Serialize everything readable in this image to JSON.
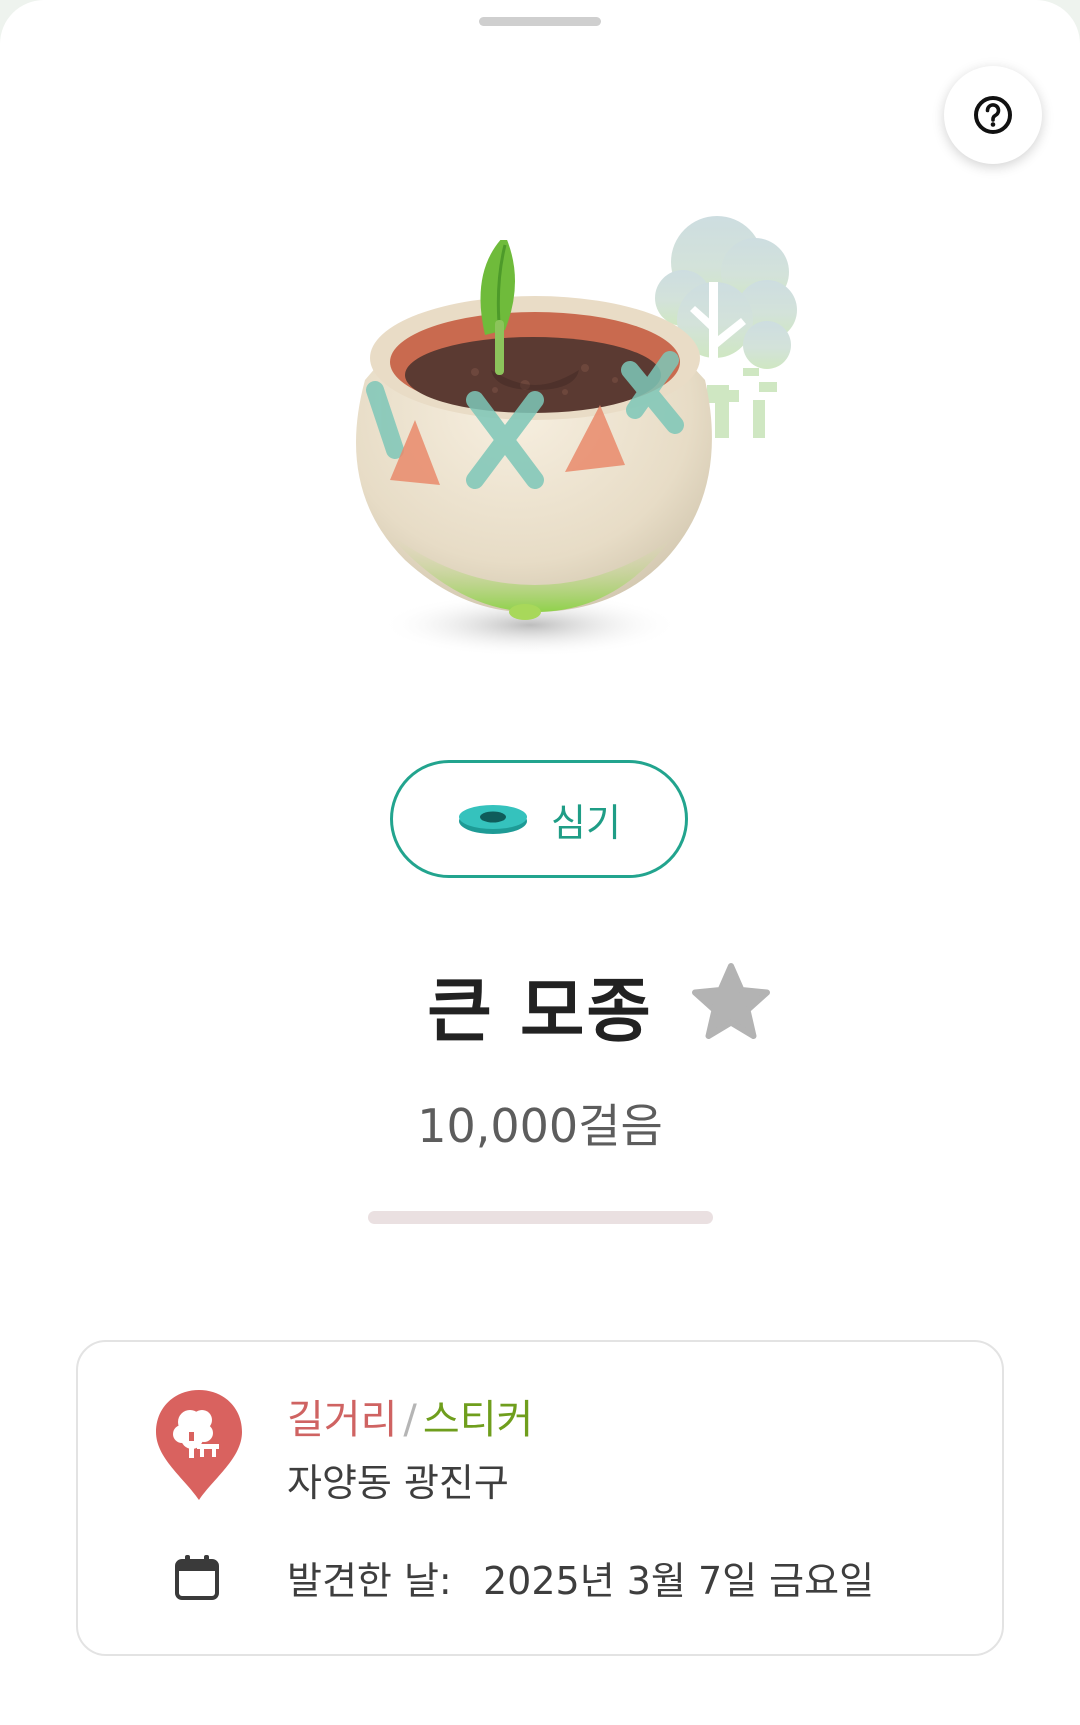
{
  "header": {
    "help_icon": "question-circle-icon"
  },
  "item": {
    "name": "큰 모종",
    "steps": "10,000걸음",
    "steps_progress": 0,
    "favorited": false,
    "image_icon": "seedling-pot-icon",
    "background_icon": "tree-bench-icon"
  },
  "actions": {
    "plant_label": "심기",
    "plant_icon": "pot-ring-icon"
  },
  "details": {
    "category_primary": "길거리",
    "category_separator": "/",
    "category_secondary": "스티커",
    "location": "자양동 광진구",
    "found_date_label": "발견한 날:",
    "found_date_value": "2025년 3월 7일 금요일",
    "pin_icon": "location-pin-tree-icon",
    "calendar_icon": "calendar-icon"
  },
  "colors": {
    "accent": "#22a48e",
    "category_primary": "#cf6362",
    "category_secondary": "#6f9e1d",
    "star_inactive": "#b3b3b3",
    "pin": "#d9625f"
  }
}
